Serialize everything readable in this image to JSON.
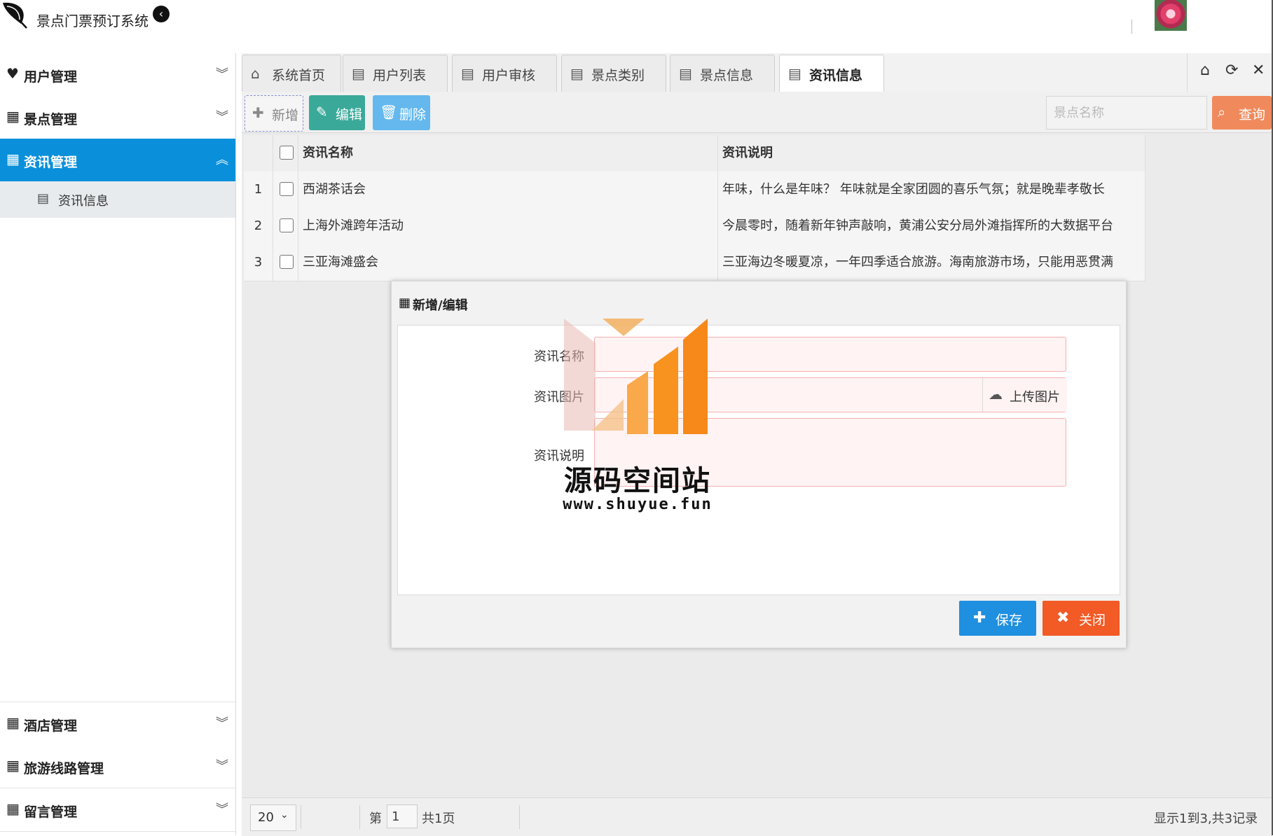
{
  "header": {
    "app_title": "景点门票预订系统",
    "collapse_icon": "chevron-left-circle-icon"
  },
  "sidebar": {
    "items": [
      {
        "label": "用户管理",
        "icon": "heartbeat-icon",
        "expanded": false
      },
      {
        "label": "景点管理",
        "icon": "table-icon",
        "expanded": false
      },
      {
        "label": "资讯管理",
        "icon": "table-icon",
        "expanded": true,
        "active": true
      },
      {
        "label": "酒店管理",
        "icon": "table-icon",
        "expanded": false
      },
      {
        "label": "旅游线路管理",
        "icon": "table-icon",
        "expanded": false
      },
      {
        "label": "留言管理",
        "icon": "table-icon",
        "expanded": false
      }
    ],
    "subitems": [
      {
        "label": "资讯信息",
        "icon": "file-icon"
      }
    ]
  },
  "tabs": [
    {
      "label": "系统首页",
      "icon": "home-icon"
    },
    {
      "label": "用户列表",
      "icon": "file-icon"
    },
    {
      "label": "用户审核",
      "icon": "file-icon"
    },
    {
      "label": "景点类别",
      "icon": "file-icon"
    },
    {
      "label": "景点信息",
      "icon": "file-icon"
    },
    {
      "label": "资讯信息",
      "icon": "file-icon",
      "active": true
    }
  ],
  "toolbar": {
    "add_label": "新增",
    "edit_label": "编辑",
    "delete_label": "删除",
    "search_placeholder": "景点名称",
    "query_label": "查询"
  },
  "grid": {
    "columns": [
      "资讯名称",
      "资讯说明"
    ],
    "rows": [
      {
        "num": "1",
        "name": "西湖茶话会",
        "desc": "年味，什么是年味？ 年味就是全家团圆的喜乐气氛；就是晚辈孝敬长"
      },
      {
        "num": "2",
        "name": "上海外滩跨年活动",
        "desc": "今晨零时，随着新年钟声敲响，黄浦公安分局外滩指挥所的大数据平台"
      },
      {
        "num": "3",
        "name": "三亚海滩盛会",
        "desc": "三亚海边冬暖夏凉，一年四季适合旅游。海南旅游市场，只能用恶贯满"
      }
    ]
  },
  "pager": {
    "page_size": "20",
    "page_prefix": "第",
    "page_value": "1",
    "page_suffix": "共1页",
    "summary": "显示1到3,共3记录"
  },
  "dialog": {
    "title": "新增/编辑",
    "field_name_label": "资讯名称",
    "field_image_label": "资讯图片",
    "field_desc_label": "资讯说明",
    "upload_label": "上传图片",
    "save_label": "保存",
    "close_label": "关闭"
  },
  "watermark": {
    "title": "源码空间站",
    "url": "www.shuyue.fun"
  },
  "colors": {
    "sidebar_active": "#0a90da",
    "edit_button": "#3aa99a",
    "delete_button": "#64b8ee",
    "query_button": "#f08a5d",
    "save_button": "#1f8fe0",
    "close_button": "#f25a26",
    "watermark_orange": "#f7931e"
  }
}
